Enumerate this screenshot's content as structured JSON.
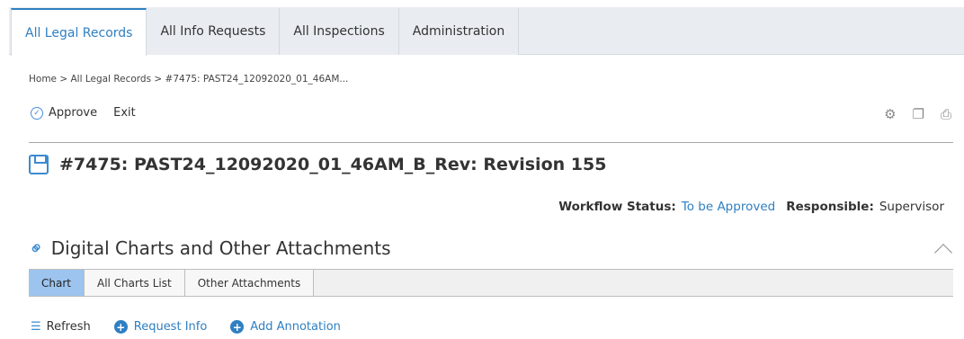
{
  "tabs": [
    {
      "label": "All Legal Records",
      "active": true
    },
    {
      "label": "All Info Requests",
      "active": false
    },
    {
      "label": "All Inspections",
      "active": false
    },
    {
      "label": "Administration",
      "active": false
    }
  ],
  "breadcrumb": "Home > All Legal Records > #7475: PAST24_12092020_01_46AM...",
  "toolbar": {
    "approve_label": "Approve",
    "exit_label": "Exit",
    "icons": [
      "gear-icon",
      "popout-icon",
      "print-icon"
    ]
  },
  "record": {
    "title": "#7475: PAST24_12092020_01_46AM_B_Rev: Revision 155",
    "icon": "save-icon"
  },
  "status": {
    "workflow_label": "Workflow Status:",
    "workflow_value": "To be Approved",
    "responsible_label": "Responsible:",
    "responsible_value": "Supervisor"
  },
  "section": {
    "title": "Digital Charts and Other Attachments",
    "icon": "link-icon"
  },
  "subtabs": [
    {
      "label": "Chart",
      "active": true
    },
    {
      "label": "All Charts List",
      "active": false
    },
    {
      "label": "Other Attachments",
      "active": false
    }
  ],
  "bottom_actions": {
    "refresh_label": "Refresh",
    "request_info_label": "Request Info",
    "add_annotation_label": "Add Annotation"
  },
  "colors": {
    "accent": "#2f7fc1",
    "active_subtab": "#9cc4ee"
  }
}
